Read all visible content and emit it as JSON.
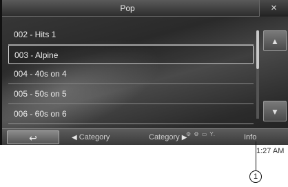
{
  "title": "Pop",
  "close_icon": "×",
  "list": {
    "items": [
      {
        "label": "002 - Hits 1"
      },
      {
        "label": "003 - Alpine"
      },
      {
        "label": "004 - 40s on 4"
      },
      {
        "label": "005 - 50s on 5"
      },
      {
        "label": "006 - 60s on 6"
      }
    ],
    "selected_index": 1
  },
  "side": {
    "top_icon": "skip-to-top-icon",
    "top_glyph": "▲",
    "bottom_icon": "skip-to-bottom-icon",
    "bottom_glyph": "▼"
  },
  "bottom": {
    "back_glyph": "↩",
    "category_prev_label": "Category",
    "category_next_label": "Category",
    "prev_arrow": "◀",
    "next_arrow": "▶",
    "info_label": "Info"
  },
  "status": {
    "icons_text": "⚙ ⚙ ▭ Y.",
    "time": "1:27 AM"
  },
  "callout": "1"
}
